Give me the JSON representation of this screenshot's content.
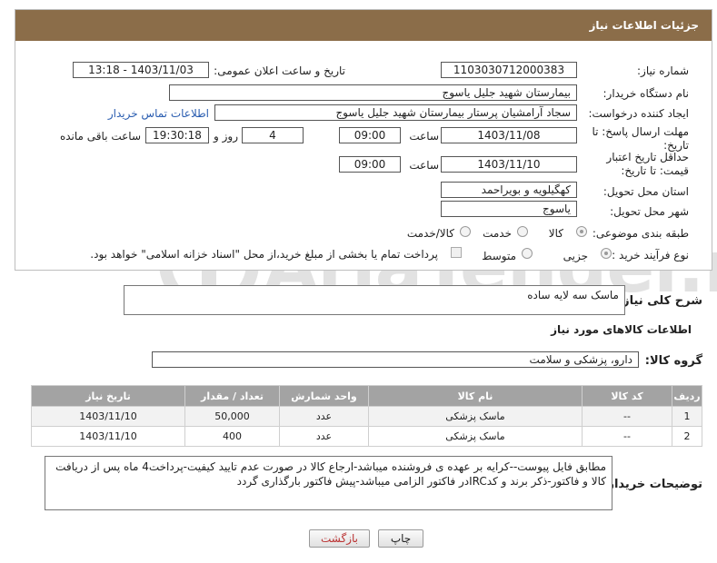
{
  "header": {
    "title": "جزئیات اطلاعات نیاز"
  },
  "fields": {
    "need_number_label": "شماره نیاز:",
    "need_number": "1103030712000383",
    "announce_label": "تاریخ و ساعت اعلان عمومی:",
    "announce_value": "1403/11/03 - 13:18",
    "buyer_org_label": "نام دستگاه خریدار:",
    "buyer_org": "بیمارستان شهید جلیل یاسوج",
    "requester_label": "ایجاد کننده درخواست:",
    "requester": "سجاد آرامشیان پرستار بیمارستان شهید جلیل یاسوج",
    "buyer_contact_link": "اطلاعات تماس خریدار",
    "deadline_label": "مهلت ارسال پاسخ: تا تاریخ:",
    "deadline_date": "1403/11/08",
    "time_label": "ساعت",
    "deadline_time": "09:00",
    "days_value": "4",
    "days_label": "روز و",
    "remaining_time": "19:30:18",
    "remaining_label": "ساعت باقی مانده",
    "validity_label": "حداقل تاریخ اعتبار قیمت: تا تاریخ:",
    "validity_date": "1403/11/10",
    "validity_time": "09:00",
    "province_label": "استان محل تحویل:",
    "province": "کهگیلویه و بویراحمد",
    "city_label": "شهر محل تحویل:",
    "city": "یاسوج",
    "category_label": "طبقه بندی موضوعی:",
    "category_options": [
      "کالا",
      "خدمت",
      "کالا/خدمت"
    ],
    "purchase_type_label": "نوع فرآیند خرید :",
    "purchase_type_options": [
      "جزیی",
      "متوسط"
    ],
    "payment_note": "پرداخت تمام یا بخشی از مبلغ خرید،از محل \"اسناد خزانه اسلامی\" خواهد بود."
  },
  "summary": {
    "label": "شرح کلی نیاز:",
    "value": "ماسک سه لایه ساده"
  },
  "goods_section_title": "اطلاعات کالاهای مورد نیاز",
  "goods_group": {
    "label": "گروه کالا:",
    "value": "دارو، پزشکی و سلامت"
  },
  "table": {
    "headers": [
      "ردیف",
      "کد کالا",
      "نام کالا",
      "واحد شمارش",
      "تعداد / مقدار",
      "تاریخ نیاز"
    ],
    "rows": [
      [
        "1",
        "--",
        "ماسک پزشکی",
        "عدد",
        "50,000",
        "1403/11/10"
      ],
      [
        "2",
        "--",
        "ماسک پزشکی",
        "عدد",
        "400",
        "1403/11/10"
      ]
    ]
  },
  "buyer_notes": {
    "label": "توضیحات خریدار:",
    "value": "مطابق فایل پیوست--کرایه بر عهده ی فروشنده میباشد-ارجاع کالا در صورت عدم تایید کیفیت-پرداخت4 ماه پس از دریافت کالا و فاکتور-ذکر برند و کدIRCدر فاکتور الزامی میباشد-پیش فاکتور بارگذاری گردد"
  },
  "buttons": {
    "print": "چاپ",
    "back": "بازگشت"
  },
  "watermark": {
    "text": "AriaTender.net"
  }
}
